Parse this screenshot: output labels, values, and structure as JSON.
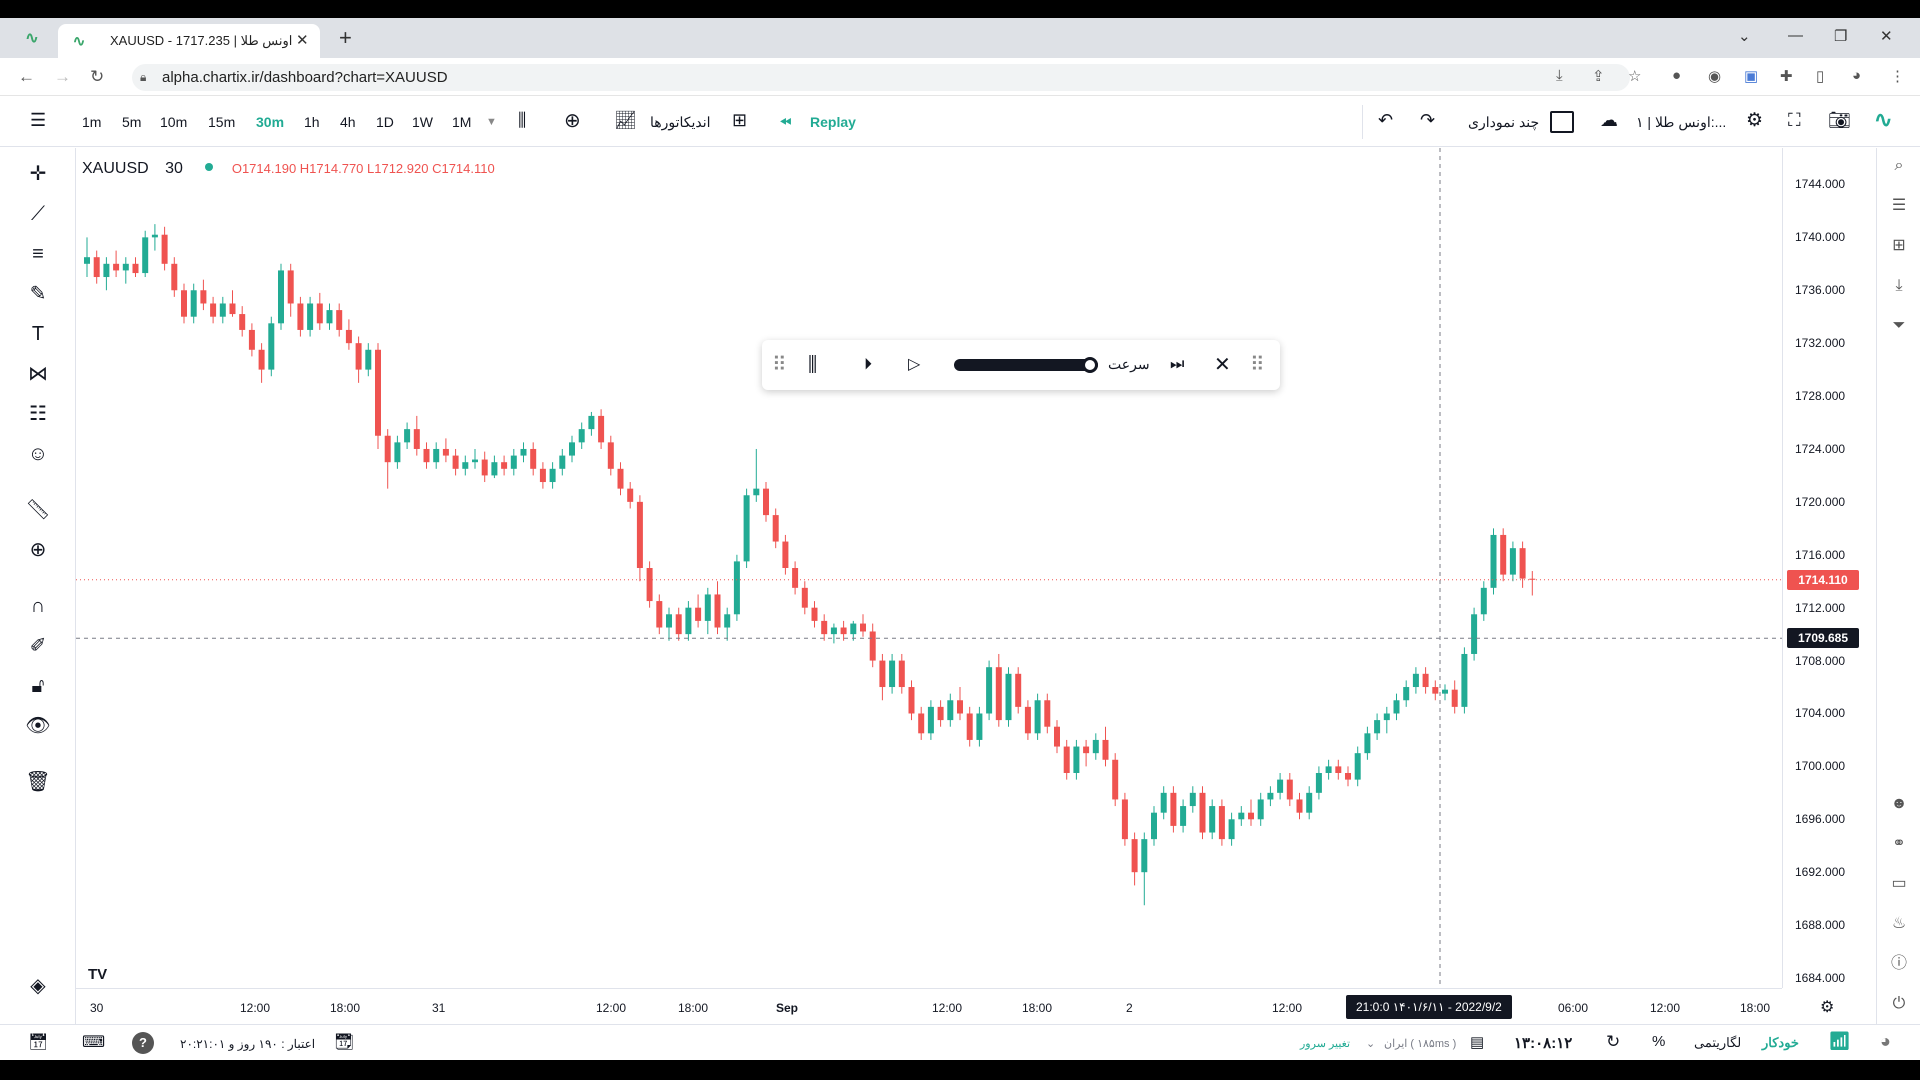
{
  "browser": {
    "tab_title": "XAUUSD - 1717.235 | اونس طلا",
    "url": "alpha.chartix.ir/dashboard?chart=XAUUSD"
  },
  "toolbar": {
    "intervals": [
      "1m",
      "5m",
      "10m",
      "15m",
      "30m",
      "1h",
      "4h",
      "1D",
      "1W",
      "1M"
    ],
    "active_interval": "30m",
    "indicators_label": "اندیکاتورها",
    "replay_label": "Replay",
    "multi_chart_label": "چند نموداری",
    "layout_name": "اونس طلا | ۱:..."
  },
  "legend": {
    "symbol": "XAUUSD",
    "timeframe": "30",
    "ohlc": "O1714.190  H1714.770  L1712.920  C1714.110"
  },
  "replay_bar": {
    "speed_label": "سرعت",
    "speed_level": 1.0
  },
  "price_axis": {
    "labels": [
      "1744.000",
      "1740.000",
      "1736.000",
      "1732.000",
      "1728.000",
      "1724.000",
      "1720.000",
      "1716.000",
      "1712.000",
      "1708.000",
      "1704.000",
      "1700.000",
      "1696.000",
      "1692.000",
      "1688.000",
      "1684.000"
    ],
    "last_price": "1714.110",
    "cursor_price": "1709.685",
    "colors": {
      "last_price": "#ef5350",
      "cursor": "#131722"
    }
  },
  "time_axis": {
    "labels": [
      "30",
      "12:00",
      "18:00",
      "31",
      "12:00",
      "18:00",
      "Sep",
      "12:00",
      "18:00",
      "2",
      "12:00",
      "06:00",
      "12:00",
      "18:00"
    ],
    "cursor_time": "21:0:0  ۱۴۰۱/۶/۱۱ - 2022/9/2"
  },
  "status": {
    "credit_text": "اعتبار : ۱۹۰ روز و ۲۰:۲۱:۰۱",
    "server_change": "تغییر سرور",
    "server_name": "ایران ( ۱۸۵ms )",
    "clock": "۱۳:۰۸:۱۲",
    "log_label": "لگاریتمی",
    "auto_label": "خودکار",
    "percent_label": "%"
  },
  "chart_data": {
    "type": "candlestick",
    "symbol": "XAUUSD",
    "interval": "30",
    "ylim": [
      1684,
      1746
    ],
    "colors": {
      "up": "#22ab94",
      "down": "#ef5350"
    },
    "candles": [
      [
        1738,
        1740,
        1737,
        1738.5
      ],
      [
        1738.5,
        1739,
        1736.5,
        1737
      ],
      [
        1737,
        1738.5,
        1736,
        1738
      ],
      [
        1738,
        1739,
        1737,
        1737.5
      ],
      [
        1737.5,
        1738.5,
        1736.5,
        1738
      ],
      [
        1738,
        1738.5,
        1737,
        1737.3
      ],
      [
        1737.3,
        1740.5,
        1737,
        1740
      ],
      [
        1740,
        1741,
        1739,
        1740.2
      ],
      [
        1740.2,
        1740.8,
        1737.5,
        1738
      ],
      [
        1738,
        1738.5,
        1735.5,
        1736
      ],
      [
        1736,
        1736.5,
        1733.5,
        1734
      ],
      [
        1734,
        1736.5,
        1733.5,
        1736
      ],
      [
        1736,
        1736.8,
        1734.5,
        1735
      ],
      [
        1735,
        1735.5,
        1733.5,
        1734
      ],
      [
        1734,
        1735.5,
        1733.5,
        1735
      ],
      [
        1735,
        1736,
        1734,
        1734.2
      ],
      [
        1734.2,
        1734.8,
        1732.5,
        1733
      ],
      [
        1733,
        1733.5,
        1731,
        1731.5
      ],
      [
        1731.5,
        1732,
        1729,
        1730
      ],
      [
        1730,
        1734,
        1729.5,
        1733.5
      ],
      [
        1733.5,
        1738,
        1733,
        1737.5
      ],
      [
        1737.5,
        1738,
        1734,
        1735
      ],
      [
        1735,
        1735.5,
        1732.5,
        1733
      ],
      [
        1733,
        1735.5,
        1732.5,
        1735
      ],
      [
        1735,
        1735.8,
        1733,
        1733.5
      ],
      [
        1733.5,
        1735,
        1733,
        1734.5
      ],
      [
        1734.5,
        1735,
        1732.5,
        1733
      ],
      [
        1733,
        1733.8,
        1731.5,
        1732
      ],
      [
        1732,
        1732.5,
        1729,
        1730
      ],
      [
        1730,
        1732,
        1729.5,
        1731.5
      ],
      [
        1731.5,
        1732,
        1724,
        1725
      ],
      [
        1725,
        1725.5,
        1721,
        1723
      ],
      [
        1723,
        1725,
        1722.5,
        1724.5
      ],
      [
        1724.5,
        1726,
        1724,
        1725.5
      ],
      [
        1725.5,
        1726.5,
        1723.5,
        1724
      ],
      [
        1724,
        1724.5,
        1722.5,
        1723
      ],
      [
        1723,
        1724.5,
        1722.5,
        1724
      ],
      [
        1724,
        1724.8,
        1723,
        1723.5
      ],
      [
        1723.5,
        1724,
        1722,
        1722.5
      ],
      [
        1722.5,
        1723.5,
        1722,
        1723
      ],
      [
        1723,
        1724,
        1722.5,
        1723.2
      ],
      [
        1723.2,
        1723.8,
        1721.5,
        1722
      ],
      [
        1722,
        1723.5,
        1721.8,
        1723
      ],
      [
        1723,
        1723.5,
        1722,
        1722.5
      ],
      [
        1722.5,
        1724,
        1722,
        1723.5
      ],
      [
        1723.5,
        1724.5,
        1723,
        1724
      ],
      [
        1724,
        1724.5,
        1722,
        1722.5
      ],
      [
        1722.5,
        1723,
        1721,
        1721.5
      ],
      [
        1721.5,
        1723,
        1721,
        1722.5
      ],
      [
        1722.5,
        1724,
        1722,
        1723.5
      ],
      [
        1723.5,
        1725,
        1723,
        1724.5
      ],
      [
        1724.5,
        1726,
        1724,
        1725.5
      ],
      [
        1725.5,
        1726.8,
        1725,
        1726.5
      ],
      [
        1726.5,
        1727,
        1724,
        1724.5
      ],
      [
        1724.5,
        1725,
        1722,
        1722.5
      ],
      [
        1722.5,
        1723,
        1720.5,
        1721
      ],
      [
        1721,
        1721.5,
        1719.5,
        1720
      ],
      [
        1720,
        1720.5,
        1714,
        1715
      ],
      [
        1715,
        1715.5,
        1712,
        1712.5
      ],
      [
        1712.5,
        1713,
        1710,
        1710.5
      ],
      [
        1710.5,
        1712,
        1709.5,
        1711.5
      ],
      [
        1711.5,
        1712,
        1709.5,
        1710
      ],
      [
        1710,
        1712.5,
        1709.5,
        1712
      ],
      [
        1712,
        1713,
        1710.5,
        1711
      ],
      [
        1711,
        1713.5,
        1710,
        1713
      ],
      [
        1713,
        1714,
        1710,
        1710.5
      ],
      [
        1710.5,
        1712,
        1709.5,
        1711.5
      ],
      [
        1711.5,
        1716,
        1711,
        1715.5
      ],
      [
        1715.5,
        1721,
        1715,
        1720.5
      ],
      [
        1720.5,
        1724,
        1720,
        1721
      ],
      [
        1721,
        1721.5,
        1718.5,
        1719
      ],
      [
        1719,
        1719.5,
        1716.5,
        1717
      ],
      [
        1717,
        1717.5,
        1714.5,
        1715
      ],
      [
        1715,
        1715.5,
        1713,
        1713.5
      ],
      [
        1713.5,
        1714,
        1711.5,
        1712
      ],
      [
        1712,
        1712.5,
        1710.5,
        1711
      ],
      [
        1711,
        1711.5,
        1709.5,
        1710
      ],
      [
        1710,
        1710.8,
        1709.3,
        1710.5
      ],
      [
        1710.5,
        1711,
        1709.5,
        1710
      ],
      [
        1710,
        1711,
        1709.5,
        1710.8
      ],
      [
        1710.8,
        1711.5,
        1709.8,
        1710.2
      ],
      [
        1710.2,
        1710.8,
        1707.5,
        1708
      ],
      [
        1708,
        1708.5,
        1705,
        1706
      ],
      [
        1706,
        1708.5,
        1705.5,
        1708
      ],
      [
        1708,
        1708.5,
        1705.5,
        1706
      ],
      [
        1706,
        1706.5,
        1703.5,
        1704
      ],
      [
        1704,
        1704.5,
        1702,
        1702.5
      ],
      [
        1702.5,
        1705,
        1702,
        1704.5
      ],
      [
        1704.5,
        1705,
        1703,
        1703.5
      ],
      [
        1703.5,
        1705.5,
        1703,
        1705
      ],
      [
        1705,
        1706,
        1703.5,
        1704
      ],
      [
        1704,
        1704.5,
        1701.5,
        1702
      ],
      [
        1702,
        1704.5,
        1701.5,
        1704
      ],
      [
        1704,
        1708,
        1703.5,
        1707.5
      ],
      [
        1707.5,
        1708.5,
        1703,
        1703.5
      ],
      [
        1703.5,
        1707.5,
        1703,
        1707
      ],
      [
        1707,
        1707.5,
        1704,
        1704.5
      ],
      [
        1704.5,
        1705,
        1702,
        1702.5
      ],
      [
        1702.5,
        1705.5,
        1702,
        1705
      ],
      [
        1705,
        1705.5,
        1702.5,
        1703
      ],
      [
        1703,
        1703.5,
        1701,
        1701.5
      ],
      [
        1701.5,
        1702,
        1699,
        1699.5
      ],
      [
        1699.5,
        1702,
        1699,
        1701.5
      ],
      [
        1701.5,
        1702,
        1700,
        1701
      ],
      [
        1701,
        1702.5,
        1700.5,
        1702
      ],
      [
        1702,
        1703,
        1700,
        1700.5
      ],
      [
        1700.5,
        1701,
        1697,
        1697.5
      ],
      [
        1697.5,
        1698,
        1694,
        1694.5
      ],
      [
        1694.5,
        1695,
        1691,
        1692
      ],
      [
        1692,
        1695,
        1689.5,
        1694.5
      ],
      [
        1694.5,
        1697,
        1694,
        1696.5
      ],
      [
        1696.5,
        1698.5,
        1696,
        1698
      ],
      [
        1698,
        1698.5,
        1695,
        1695.5
      ],
      [
        1695.5,
        1697.5,
        1695,
        1697
      ],
      [
        1697,
        1698.5,
        1696.5,
        1698
      ],
      [
        1698,
        1698.5,
        1694.5,
        1695
      ],
      [
        1695,
        1697.5,
        1694.5,
        1697
      ],
      [
        1697,
        1697.5,
        1694,
        1694.5
      ],
      [
        1694.5,
        1696.5,
        1694,
        1696
      ],
      [
        1696,
        1697,
        1695.5,
        1696.5
      ],
      [
        1696.5,
        1697.5,
        1695.5,
        1696
      ],
      [
        1696,
        1698,
        1695.5,
        1697.5
      ],
      [
        1697.5,
        1698.5,
        1697,
        1698
      ],
      [
        1698,
        1699.5,
        1697.5,
        1699
      ],
      [
        1699,
        1699.5,
        1697,
        1697.5
      ],
      [
        1697.5,
        1698,
        1696,
        1696.5
      ],
      [
        1696.5,
        1698.5,
        1696,
        1698
      ],
      [
        1698,
        1700,
        1697.5,
        1699.5
      ],
      [
        1699.5,
        1700.5,
        1699,
        1700
      ],
      [
        1700,
        1700.5,
        1699,
        1699.5
      ],
      [
        1699.5,
        1700,
        1698.5,
        1699
      ],
      [
        1699,
        1701.5,
        1698.5,
        1701
      ],
      [
        1701,
        1703,
        1700.5,
        1702.5
      ],
      [
        1702.5,
        1704,
        1702,
        1703.5
      ],
      [
        1703.5,
        1704.5,
        1702.5,
        1704
      ],
      [
        1704,
        1705.5,
        1703.5,
        1705
      ],
      [
        1705,
        1706.5,
        1704.5,
        1706
      ],
      [
        1706,
        1707.5,
        1705.5,
        1707
      ],
      [
        1707,
        1707.5,
        1705.5,
        1706
      ],
      [
        1706,
        1706.5,
        1705,
        1705.5
      ],
      [
        1705.5,
        1706.2,
        1705,
        1705.8
      ],
      [
        1705.8,
        1706.5,
        1704,
        1704.5
      ],
      [
        1704.5,
        1709,
        1704,
        1708.5
      ],
      [
        1708.5,
        1712,
        1708,
        1711.5
      ],
      [
        1711.5,
        1714,
        1711,
        1713.5
      ],
      [
        1713.5,
        1718,
        1713,
        1717.5
      ],
      [
        1717.5,
        1718,
        1714,
        1714.5
      ],
      [
        1714.5,
        1717,
        1714,
        1716.5
      ],
      [
        1716.5,
        1717,
        1713.5,
        1714.2
      ],
      [
        1714.19,
        1714.77,
        1712.92,
        1714.11
      ]
    ]
  }
}
